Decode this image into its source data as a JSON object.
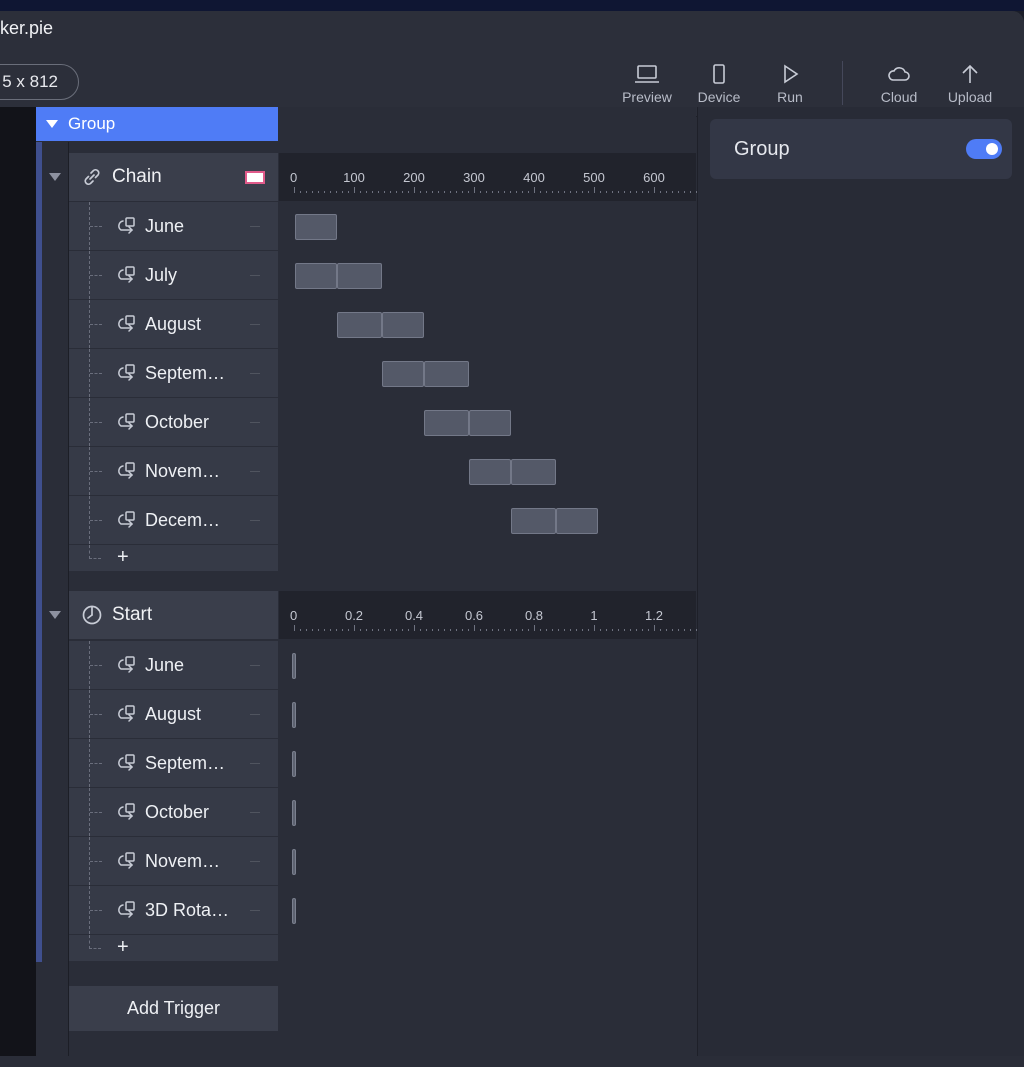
{
  "window": {
    "title": "ker.pie"
  },
  "toolbar": {
    "size": "5 x 812",
    "buttons": [
      {
        "label": "Preview",
        "icon": "laptop-icon"
      },
      {
        "label": "Device",
        "icon": "phone-icon"
      },
      {
        "label": "Run",
        "icon": "play-icon"
      },
      {
        "label": "Cloud",
        "icon": "cloud-icon"
      },
      {
        "label": "Upload",
        "icon": "upload-arrow-icon"
      }
    ]
  },
  "group_header": {
    "label": "Group"
  },
  "inspector": {
    "group_label": "Group",
    "group_toggle_on": true
  },
  "colors": {
    "accent": "#4f7cf6",
    "swatch_border": "#e05a8a"
  },
  "sections": [
    {
      "name": "Chain",
      "icon": "link-icon",
      "ruler": {
        "labels": [
          "0",
          "100",
          "200",
          "300",
          "400",
          "500",
          "600"
        ],
        "max": 700
      },
      "rows": [
        {
          "name": "June",
          "blocks": [
            [
              0,
              70
            ]
          ]
        },
        {
          "name": "July",
          "blocks": [
            [
              0,
              70
            ],
            [
              70,
              145
            ]
          ]
        },
        {
          "name": "August",
          "blocks": [
            [
              70,
              145
            ],
            [
              145,
              215
            ]
          ]
        },
        {
          "name": "Septem…",
          "blocks": [
            [
              145,
              215
            ],
            [
              215,
              290
            ]
          ]
        },
        {
          "name": "October",
          "blocks": [
            [
              215,
              290
            ],
            [
              290,
              360
            ]
          ]
        },
        {
          "name": "Novem…",
          "blocks": [
            [
              290,
              360
            ],
            [
              360,
              435
            ]
          ]
        },
        {
          "name": "Decem…",
          "blocks": [
            [
              360,
              435
            ],
            [
              435,
              505
            ]
          ]
        }
      ],
      "add_label": "+"
    },
    {
      "name": "Start",
      "icon": "timer-icon",
      "ruler": {
        "labels": [
          "0",
          "0.2",
          "0.4",
          "0.6",
          "0.8",
          "1",
          "1.2"
        ],
        "max": 1.4
      },
      "rows": [
        {
          "name": "June"
        },
        {
          "name": "August"
        },
        {
          "name": "Septem…"
        },
        {
          "name": "October"
        },
        {
          "name": "Novem…"
        },
        {
          "name": "3D Rota…"
        }
      ],
      "add_label": "+"
    }
  ],
  "add_trigger_label": "Add Trigger"
}
